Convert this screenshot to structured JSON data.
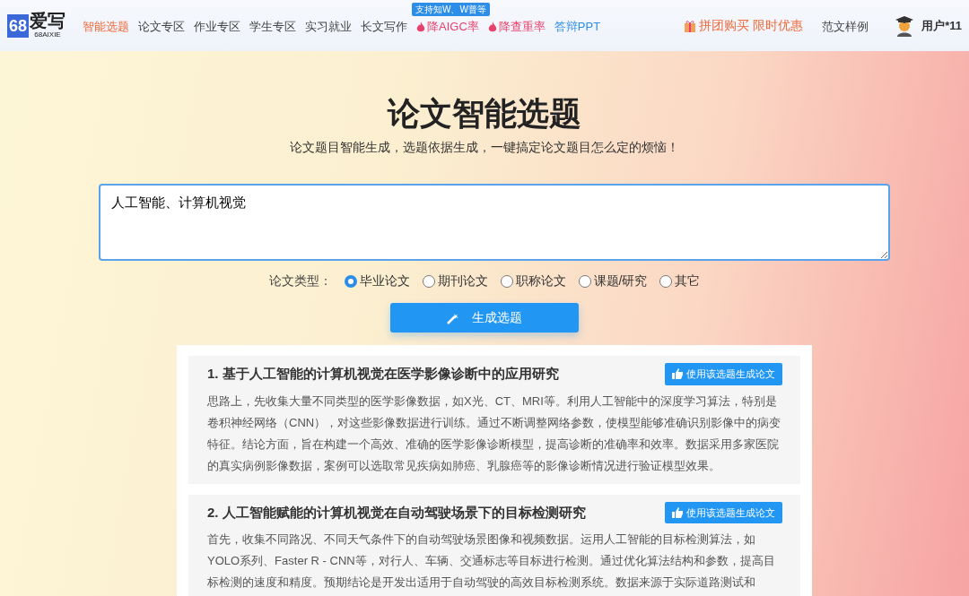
{
  "header": {
    "logo": {
      "text": "爱写",
      "digits": "68",
      "subtitle": "68AIXIE"
    },
    "nav": [
      {
        "label": "智能选题",
        "selected": true,
        "kind": "plain"
      },
      {
        "label": "论文专区",
        "selected": false,
        "kind": "plain"
      },
      {
        "label": "作业专区",
        "selected": false,
        "kind": "plain"
      },
      {
        "label": "学生专区",
        "selected": false,
        "kind": "plain"
      },
      {
        "label": "实习就业",
        "selected": false,
        "kind": "plain"
      },
      {
        "label": "长文写作",
        "selected": false,
        "kind": "plain"
      },
      {
        "label": "降AIGC率",
        "selected": false,
        "kind": "hot",
        "badge": "支持知W、W普等"
      },
      {
        "label": "降查重率",
        "selected": false,
        "kind": "hot"
      },
      {
        "label": "答辩PPT",
        "selected": false,
        "kind": "accent"
      }
    ],
    "promo": "拼团购买 限时优惠",
    "samples": "范文样例",
    "user": "用户*11"
  },
  "hero": {
    "title": "论文智能选题",
    "subtitle": "论文题目智能生成，选题依据生成，一键搞定论文题目怎么定的烦恼！"
  },
  "input": {
    "value": "人工智能、计算机视觉"
  },
  "paper_type": {
    "label": "论文类型：",
    "options": [
      {
        "label": "毕业论文",
        "selected": true
      },
      {
        "label": "期刊论文",
        "selected": false
      },
      {
        "label": "职称论文",
        "selected": false
      },
      {
        "label": "课题/研究",
        "selected": false
      },
      {
        "label": "其它",
        "selected": false
      }
    ]
  },
  "generate_button": "生成选题",
  "results": [
    {
      "title": "1. 基于人工智能的计算机视觉在医学影像诊断中的应用研究",
      "button": "使用该选题生成论文",
      "description": "思路上，先收集大量不同类型的医学影像数据，如X光、CT、MRI等。利用人工智能中的深度学习算法，特别是卷积神经网络（CNN），对这些影像数据进行训练。通过不断调整网络参数，使模型能够准确识别影像中的病变特征。结论方面，旨在构建一个高效、准确的医学影像诊断模型，提高诊断的准确率和效率。数据采用多家医院的真实病例影像数据，案例可以选取常见疾病如肺癌、乳腺癌等的影像诊断情况进行验证模型效果。"
    },
    {
      "title": "2. 人工智能赋能的计算机视觉在自动驾驶场景下的目标检测研究",
      "button": "使用该选题生成论文",
      "description": "首先，收集不同路况、不同天气条件下的自动驾驶场景图像和视频数据。运用人工智能的目标检测算法，如YOLO系列、Faster R - CNN等，对行人、车辆、交通标志等目标进行检测。通过优化算法结构和参数，提高目标检测的速度和精度。预期结论是开发出适用于自动驾驶的高效目标检测系统。数据来源于实际道路测试和"
    }
  ]
}
